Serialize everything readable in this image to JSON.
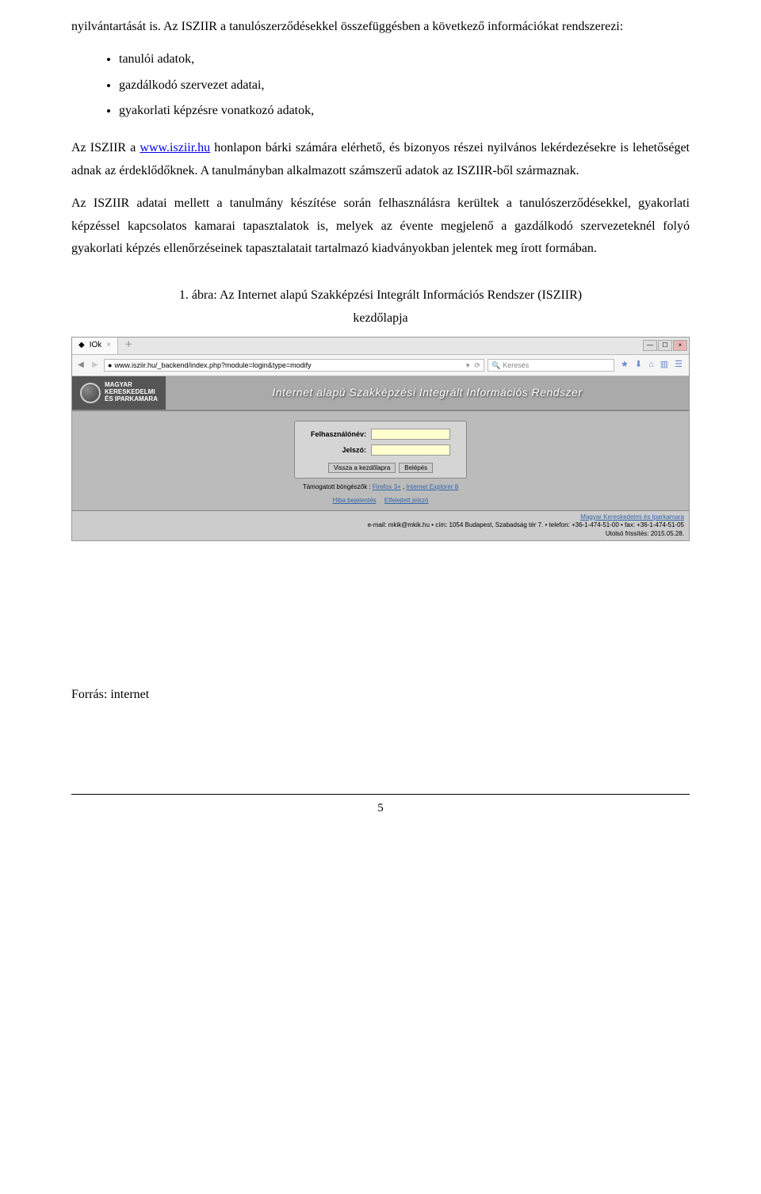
{
  "text": {
    "p1a": "nyilvántartását is. Az ISZIIR a tanulószerződésekkel összefüggésben a következő információkat rendszerezi:",
    "bullet1": "tanulói adatok,",
    "bullet2": "gazdálkodó szervezet adatai,",
    "bullet3": "gyakorlati képzésre vonatkozó adatok,",
    "p2a": "Az ISZIIR a ",
    "p2link": "www.isziir.hu",
    "p2b": " honlapon bárki számára elérhető, és bizonyos részei nyilvános lekérdezésekre is lehetőséget adnak az érdeklődőknek. A tanulmányban alkalmazott számszerű adatok az ISZIIR-ből származnak.",
    "p3": "Az ISZIIR adatai mellett a tanulmány készítése során felhasználásra kerültek a tanulószerződésekkel, gyakorlati képzéssel kapcsolatos kamarai tapasztalatok is, melyek az évente megjelenő a gazdálkodó szervezeteknél folyó gyakorlati képzés ellenőrzéseinek tapasztalatait tartalmazó kiadványokban jelentek meg írott formában.",
    "figcap1": "1. ábra: Az Internet alapú Szakképzési Integrált Információs Rendszer (ISZIIR)",
    "figcap2": "kezdőlapja",
    "source": "Forrás: internet",
    "pagenum": "5"
  },
  "browser": {
    "tab_title": "IOk",
    "url": "www.isziir.hu/_backend/index.php?module=login&type=modify",
    "search_placeholder": "Keresés",
    "logo_line1": "MAGYAR",
    "logo_line2": "KERESKEDELMI",
    "logo_line3": "ÉS IPARKAMARA",
    "site_title": "Internet alapú Szakképzési Integrált Információs Rendszer",
    "login": {
      "user_label": "Felhasználónév:",
      "pass_label": "Jelszó:",
      "back_btn": "Vissza a kezdőlapra",
      "login_btn": "Belépés",
      "support_text": "Támogatott böngészők : ",
      "support_link1": "Firefox 3+",
      "support_link2": "Internet Explorer 8",
      "help_link1": "Hiba bejelentés",
      "help_link2": "Elfelejtett jelszó"
    },
    "footer": {
      "org_link": "Magyar Kereskedelmi és Iparkamara",
      "contact": "e-mail: mkik@mkik.hu • cím: 1054 Budapest, Szabadság tér 7. • telefon: +36-1-474-51-00 • fax: +36-1-474-51-05",
      "updated": "Utolsó frissítés: 2015.05.28."
    }
  }
}
